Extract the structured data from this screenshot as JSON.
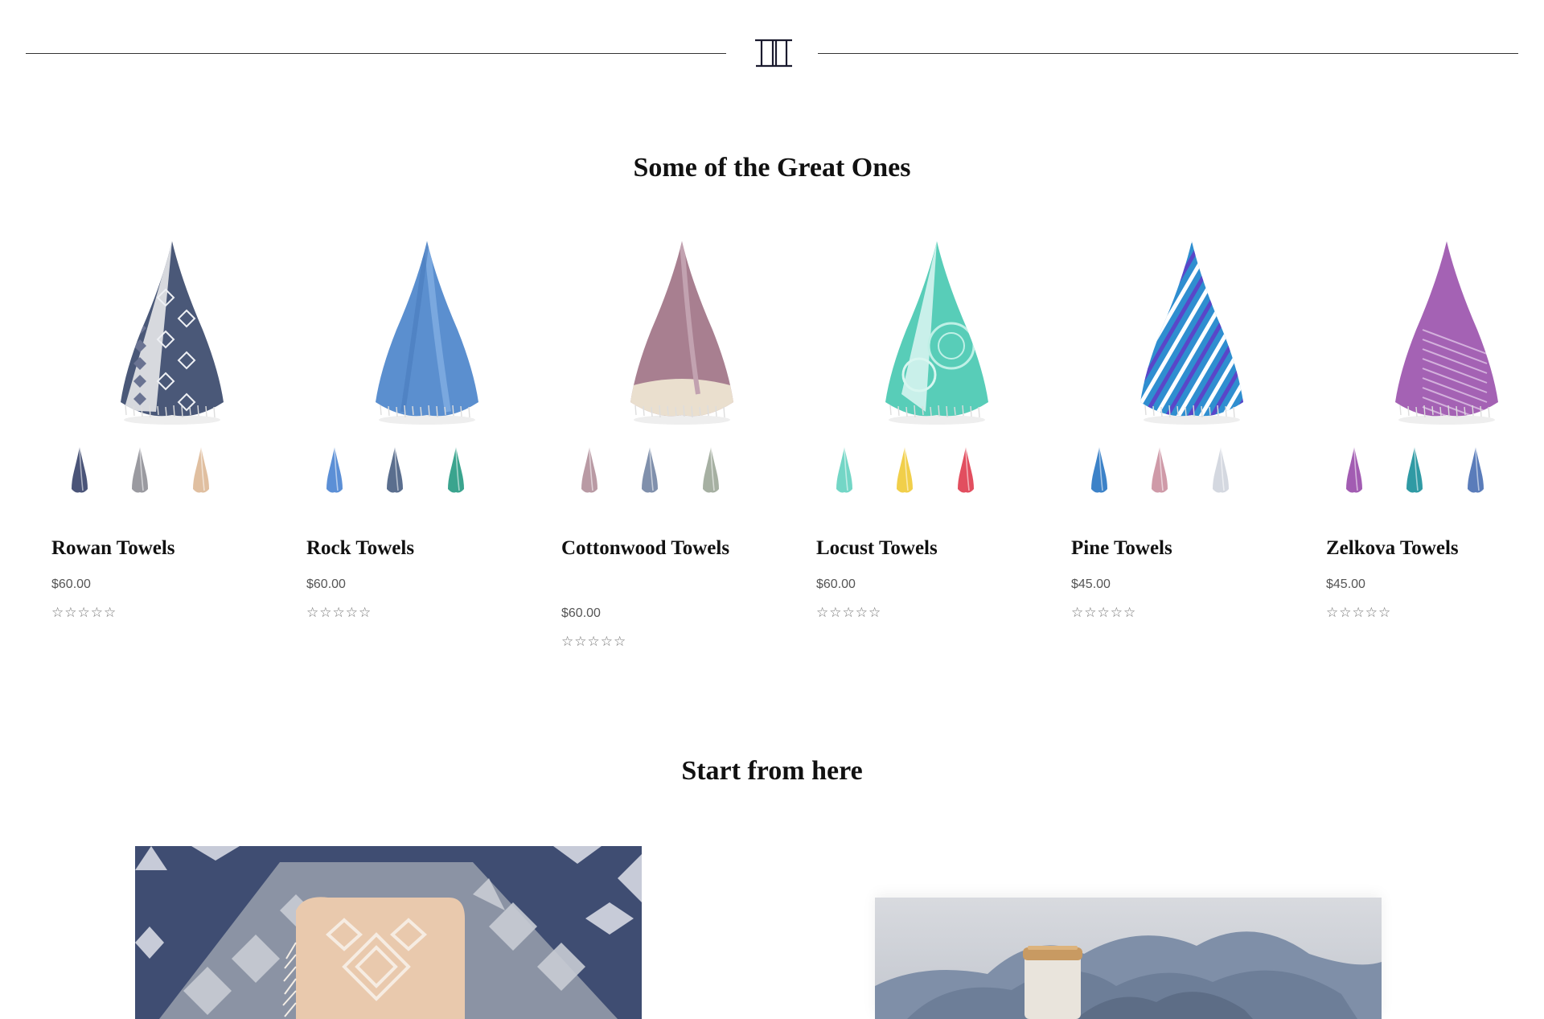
{
  "logo": {
    "icon": "double-pillar-logo-icon"
  },
  "featured": {
    "title": "Some of the Great Ones",
    "products": [
      {
        "name": "Rowan Towels",
        "price": "$60.00",
        "rating_stars": "☆☆☆☆☆",
        "rating": 0,
        "hero_color": "#4a5878",
        "pattern": "aztec",
        "swatches": [
          "#4a5478",
          "#9a9aa0",
          "#e0bfa0"
        ]
      },
      {
        "name": "Rock Towels",
        "price": "$60.00",
        "rating_stars": "☆☆☆☆☆",
        "rating": 0,
        "hero_color": "#5b8fcf",
        "pattern": "plain",
        "swatches": [
          "#5b8fd6",
          "#5a6e8e",
          "#3aa48e"
        ]
      },
      {
        "name": "Cottonwood Towels",
        "price": "$60.00",
        "rating_stars": "☆☆☆☆☆",
        "rating": 0,
        "hero_color": "#a87f90",
        "pattern": "fringe",
        "swatches": [
          "#b99aa4",
          "#8090ac",
          "#a6b0a2"
        ]
      },
      {
        "name": "Locust Towels",
        "price": "$60.00",
        "rating_stars": "☆☆☆☆☆",
        "rating": 0,
        "hero_color": "#58cdb8",
        "pattern": "mandala",
        "swatches": [
          "#73d6c6",
          "#f1cf4a",
          "#e24e5f"
        ]
      },
      {
        "name": "Pine Towels",
        "price": "$45.00",
        "rating_stars": "☆☆☆☆☆",
        "rating": 0,
        "hero_color": "#2f8ed0",
        "pattern": "stripes",
        "swatches": [
          "#3c82c8",
          "#cf9aa8",
          "#d4d8e0"
        ]
      },
      {
        "name": "Zelkova Towels",
        "price": "$45.00",
        "rating_stars": "☆☆☆☆☆",
        "rating": 0,
        "hero_color": "#a462b4",
        "pattern": "pinstripe",
        "swatches": [
          "#a25cb2",
          "#2f9aa4",
          "#5a7cba"
        ]
      }
    ]
  },
  "start": {
    "title": "Start from here",
    "banners": [
      {
        "name": "aztec-towels-banner",
        "base_color": "#3f4d72"
      },
      {
        "name": "blue-throw-candle-banner",
        "base_color": "#9aa8bc"
      }
    ]
  }
}
